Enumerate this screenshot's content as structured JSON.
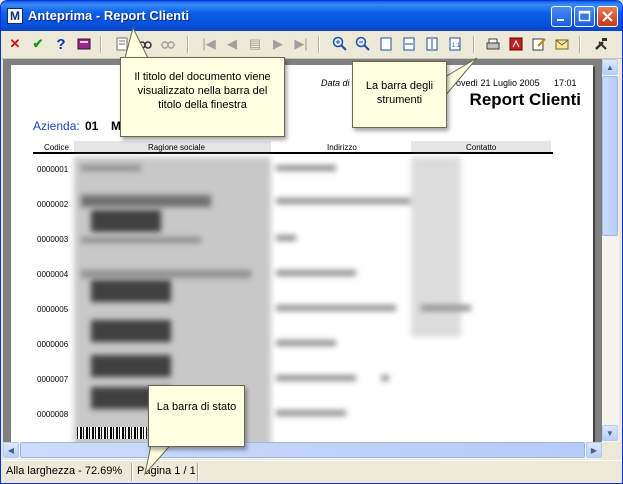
{
  "window": {
    "title": "Anteprima - Report Clienti",
    "icon_letter": "M"
  },
  "report": {
    "date_label": "Data di",
    "date_value": "ovedì 21 Luglio 2005",
    "time": "17:01",
    "title": "Report Clienti",
    "azienda_label": "Azienda:",
    "azienda_value": "01",
    "azienda_trail": "M",
    "columns": [
      "Codice",
      "Ragione sociale",
      "Indirizzo",
      "Contatto"
    ],
    "codes": [
      "0000001",
      "0000002",
      "0000003",
      "0000004",
      "0000005",
      "0000006",
      "0000007",
      "0000008"
    ]
  },
  "status": {
    "zoom": "Alla larghezza - 72.69%",
    "page": "Pagina 1 / 1"
  },
  "callouts": {
    "title_note": "Il titolo del documento viene visualizzato nella barra del titolo della finestra",
    "toolbar_note": "La barra degli strumenti",
    "status_note": "La barra di stato"
  },
  "colors": {
    "titlebar": "#0b5ee8",
    "azienda_label": "#1f3fbf",
    "callout_bg": "#ffffe1"
  }
}
